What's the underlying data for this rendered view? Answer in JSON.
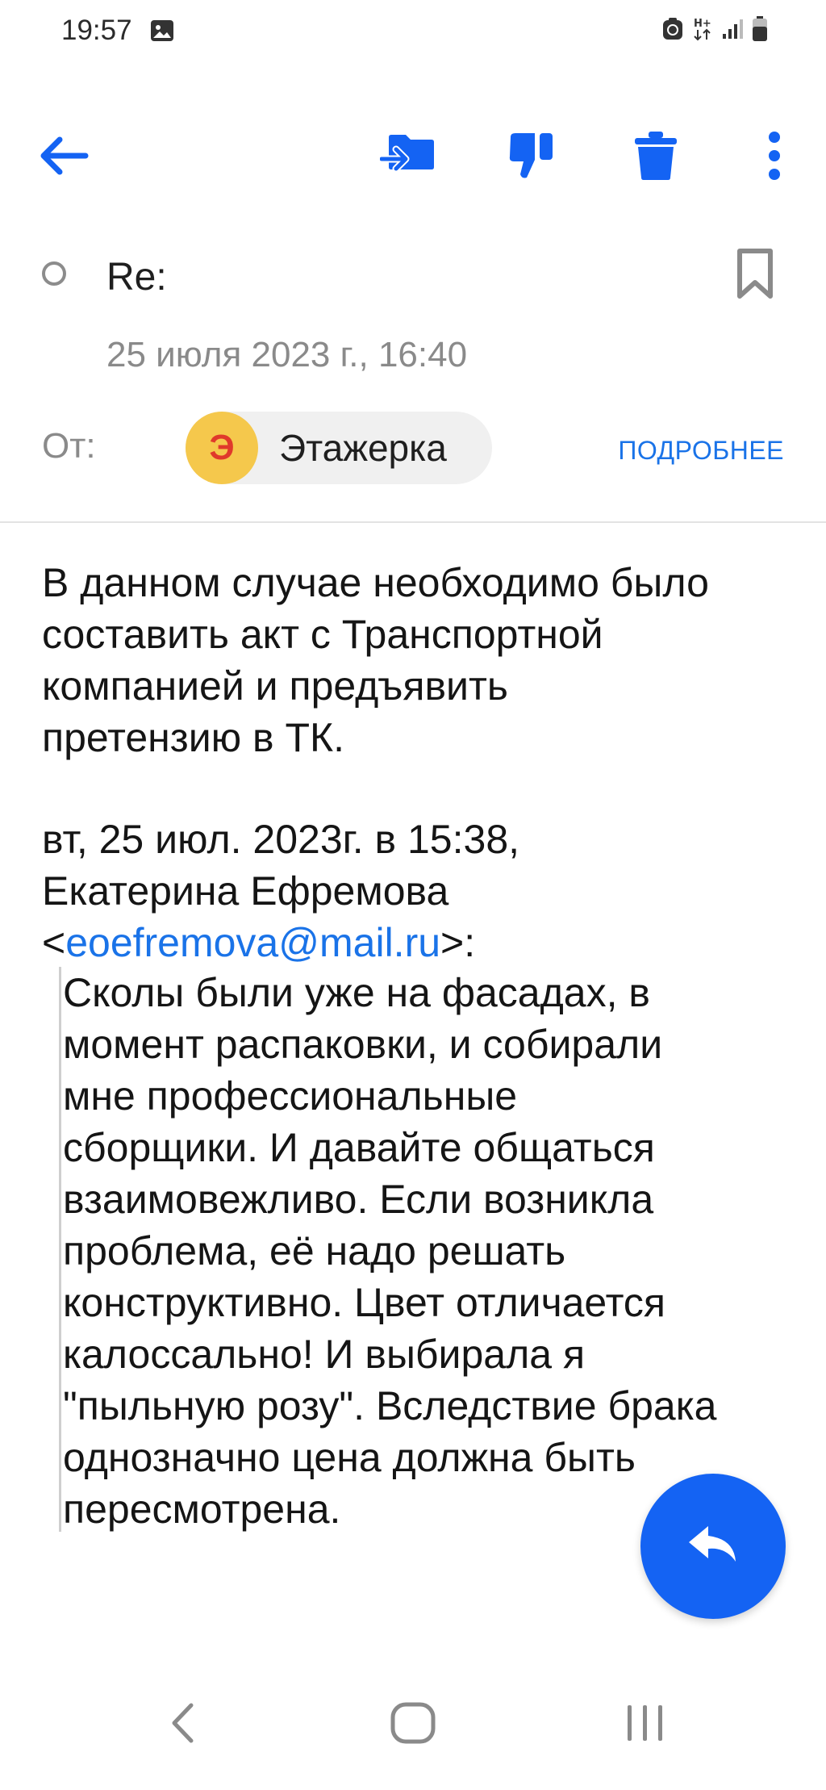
{
  "status_bar": {
    "time": "19:57",
    "icons": [
      "gallery-icon",
      "recycle-icon",
      "data-hplus-icon",
      "signal-icon",
      "battery-icon"
    ]
  },
  "toolbar": {
    "back_icon": "arrow-left-icon",
    "actions": [
      "move-to-folder-icon",
      "spam-thumbs-down-icon",
      "trash-icon",
      "more-vert-icon"
    ]
  },
  "message": {
    "subject": "Re:",
    "date": "25 июля 2023 г., 16:40",
    "from_label": "От:",
    "sender_initial": "Э",
    "sender_name": "Этажерка",
    "details_link": "ПОДРОБНЕЕ",
    "body_lines": [
      "В данном случае необходимо было",
      "составить акт с Транспортной",
      "компанией и предъявить",
      "претензию в ТК."
    ],
    "quote_header_line1": "вт, 25 июл. 2023г. в 15:38,",
    "quote_header_line2": "Екатерина Ефремова",
    "quote_email_open": "<",
    "quote_email": "eoefremova@mail.ru",
    "quote_email_close": ">:",
    "quote_lines": [
      "Сколы были уже на фасадах, в",
      "момент распаковки, и собирали",
      "мне профессиональные",
      "сборщики. И давайте общаться",
      "взаимовежливо. Если возникла",
      "проблема, её надо решать",
      "конструктивно. Цвет отличается",
      "калоссально! И выбирала я",
      "\"пыльную розу\". Вследствие брака",
      "однозначно цена должна быть",
      "пересмотрена."
    ]
  },
  "fab": {
    "icon": "reply-icon"
  },
  "colors": {
    "accent": "#1463f3",
    "link": "#1a73e8",
    "avatar_bg": "#f5c84c",
    "avatar_letter": "#e0392b",
    "muted_text": "#8a8a8a"
  },
  "nav_bar": {
    "icons": [
      "nav-back-icon",
      "nav-home-icon",
      "nav-recents-icon"
    ]
  }
}
